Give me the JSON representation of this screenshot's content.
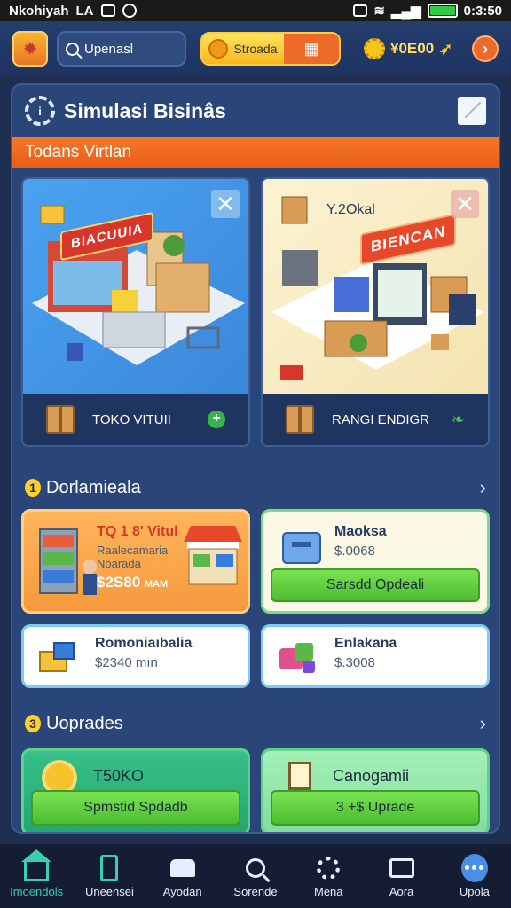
{
  "status_bar": {
    "carrier": "Nkohiyah",
    "tag": "LA",
    "time": "0:3:50"
  },
  "header": {
    "search_placeholder": "Upenasl",
    "coin_label": "Stroada",
    "money": "¥0E00"
  },
  "panel": {
    "title": "Simulasi Bisinâs",
    "banner": "Todans Virtlan"
  },
  "businesses": [
    {
      "label": "TOKO VITUII",
      "sign": "BIACUUIA",
      "badge": ""
    },
    {
      "label": "RANGI ENDIGR",
      "sign": "BIENCAN",
      "badge": "Y.2Okal"
    }
  ],
  "inventory": {
    "number": "1",
    "title": "Dorlamieala",
    "items": [
      {
        "name": "TQ 1 8' Vitul",
        "desc1": "Raalecamaria",
        "desc2": "Noarada",
        "price": "$2S80",
        "extra": "MAM"
      },
      {
        "name": "Maoksa",
        "price": "$.0068",
        "button": "Sarsdd Opdeali"
      },
      {
        "name": "Romoniaıbalia",
        "price": "$2340 mın"
      },
      {
        "name": "Enlakana",
        "price": "$.3008"
      }
    ]
  },
  "upgrades": {
    "number": "3",
    "title": "Uoprades",
    "cards": [
      {
        "title": "T50KO",
        "button": "Spmstid Spdadb"
      },
      {
        "title": "Canogamii",
        "button": "3 +$ Uprade"
      }
    ]
  },
  "nav": [
    {
      "label": "Imoendols",
      "icon": "home-icon"
    },
    {
      "label": "Uneensei",
      "icon": "phone-icon"
    },
    {
      "label": "Ayodan",
      "icon": "cart-icon"
    },
    {
      "label": "Sorende",
      "icon": "search-icon"
    },
    {
      "label": "Mena",
      "icon": "gear-icon"
    },
    {
      "label": "Aora",
      "icon": "chat-icon"
    },
    {
      "label": "Upola",
      "icon": "more-icon"
    }
  ],
  "colors": {
    "accent_orange": "#e85d14",
    "accent_green": "#4bbd2f",
    "panel_bg": "#2a4578",
    "nav_active": "#39d0ad"
  }
}
